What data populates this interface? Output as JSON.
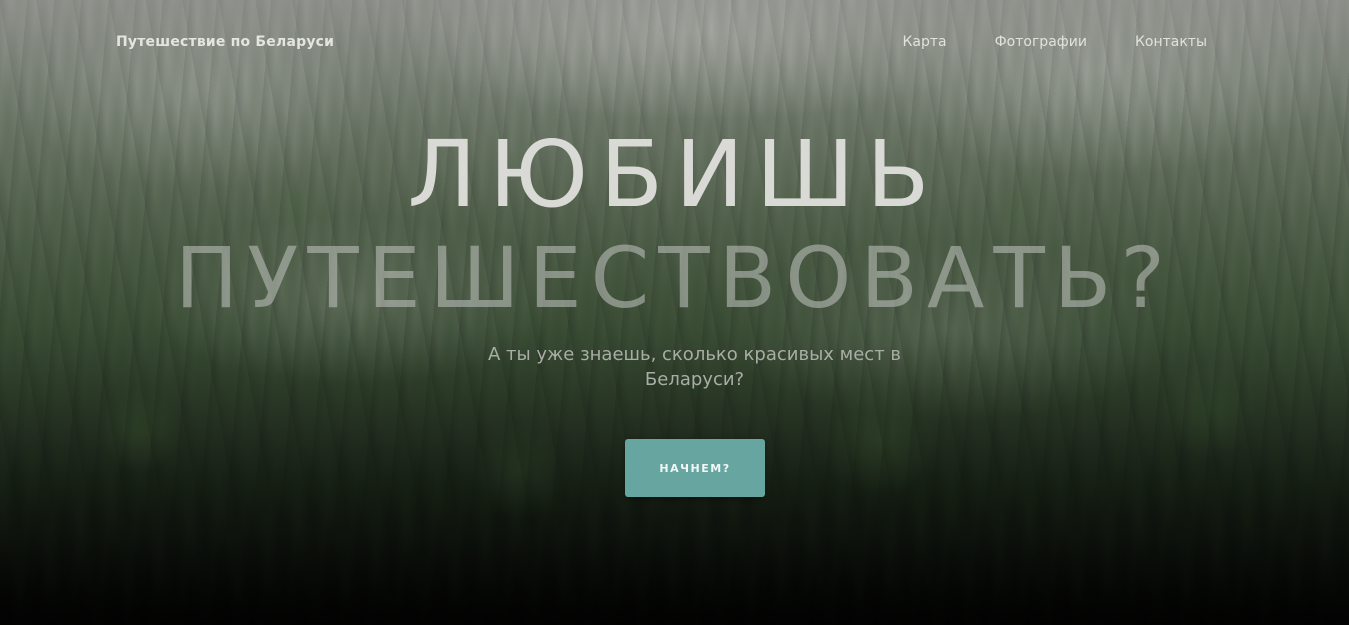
{
  "nav": {
    "brand": "Путешествие по Беларуси",
    "links": [
      "Карта",
      "Фотографии",
      "Контакты"
    ]
  },
  "hero": {
    "headline_line1": "ЛЮБИШЬ",
    "headline_line2": "ПУТЕШЕСТВОВАТЬ?",
    "subtitle": "А ты уже знаешь, сколько красивых мест в Беларуси?",
    "cta_label": "НАЧНЕМ?",
    "background": "foggy-forest-photo"
  },
  "colors": {
    "accent": "#67a5a1",
    "nav_text": "#e0e2de",
    "headline": "#d9d9d6"
  }
}
